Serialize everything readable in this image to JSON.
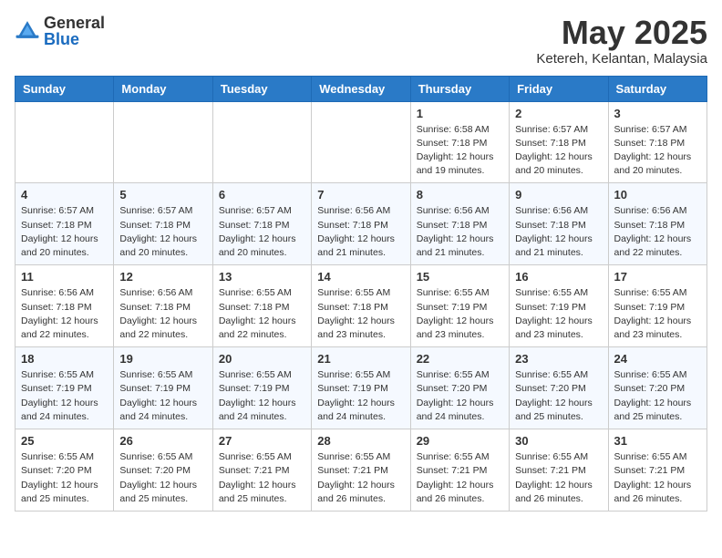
{
  "header": {
    "logo": {
      "general": "General",
      "blue": "Blue"
    },
    "title": "May 2025",
    "location": "Ketereh, Kelantan, Malaysia"
  },
  "weekdays": [
    "Sunday",
    "Monday",
    "Tuesday",
    "Wednesday",
    "Thursday",
    "Friday",
    "Saturday"
  ],
  "weeks": [
    [
      {
        "day": "",
        "info": ""
      },
      {
        "day": "",
        "info": ""
      },
      {
        "day": "",
        "info": ""
      },
      {
        "day": "",
        "info": ""
      },
      {
        "day": "1",
        "info": "Sunrise: 6:58 AM\nSunset: 7:18 PM\nDaylight: 12 hours\nand 19 minutes."
      },
      {
        "day": "2",
        "info": "Sunrise: 6:57 AM\nSunset: 7:18 PM\nDaylight: 12 hours\nand 20 minutes."
      },
      {
        "day": "3",
        "info": "Sunrise: 6:57 AM\nSunset: 7:18 PM\nDaylight: 12 hours\nand 20 minutes."
      }
    ],
    [
      {
        "day": "4",
        "info": "Sunrise: 6:57 AM\nSunset: 7:18 PM\nDaylight: 12 hours\nand 20 minutes."
      },
      {
        "day": "5",
        "info": "Sunrise: 6:57 AM\nSunset: 7:18 PM\nDaylight: 12 hours\nand 20 minutes."
      },
      {
        "day": "6",
        "info": "Sunrise: 6:57 AM\nSunset: 7:18 PM\nDaylight: 12 hours\nand 20 minutes."
      },
      {
        "day": "7",
        "info": "Sunrise: 6:56 AM\nSunset: 7:18 PM\nDaylight: 12 hours\nand 21 minutes."
      },
      {
        "day": "8",
        "info": "Sunrise: 6:56 AM\nSunset: 7:18 PM\nDaylight: 12 hours\nand 21 minutes."
      },
      {
        "day": "9",
        "info": "Sunrise: 6:56 AM\nSunset: 7:18 PM\nDaylight: 12 hours\nand 21 minutes."
      },
      {
        "day": "10",
        "info": "Sunrise: 6:56 AM\nSunset: 7:18 PM\nDaylight: 12 hours\nand 22 minutes."
      }
    ],
    [
      {
        "day": "11",
        "info": "Sunrise: 6:56 AM\nSunset: 7:18 PM\nDaylight: 12 hours\nand 22 minutes."
      },
      {
        "day": "12",
        "info": "Sunrise: 6:56 AM\nSunset: 7:18 PM\nDaylight: 12 hours\nand 22 minutes."
      },
      {
        "day": "13",
        "info": "Sunrise: 6:55 AM\nSunset: 7:18 PM\nDaylight: 12 hours\nand 22 minutes."
      },
      {
        "day": "14",
        "info": "Sunrise: 6:55 AM\nSunset: 7:18 PM\nDaylight: 12 hours\nand 23 minutes."
      },
      {
        "day": "15",
        "info": "Sunrise: 6:55 AM\nSunset: 7:19 PM\nDaylight: 12 hours\nand 23 minutes."
      },
      {
        "day": "16",
        "info": "Sunrise: 6:55 AM\nSunset: 7:19 PM\nDaylight: 12 hours\nand 23 minutes."
      },
      {
        "day": "17",
        "info": "Sunrise: 6:55 AM\nSunset: 7:19 PM\nDaylight: 12 hours\nand 23 minutes."
      }
    ],
    [
      {
        "day": "18",
        "info": "Sunrise: 6:55 AM\nSunset: 7:19 PM\nDaylight: 12 hours\nand 24 minutes."
      },
      {
        "day": "19",
        "info": "Sunrise: 6:55 AM\nSunset: 7:19 PM\nDaylight: 12 hours\nand 24 minutes."
      },
      {
        "day": "20",
        "info": "Sunrise: 6:55 AM\nSunset: 7:19 PM\nDaylight: 12 hours\nand 24 minutes."
      },
      {
        "day": "21",
        "info": "Sunrise: 6:55 AM\nSunset: 7:19 PM\nDaylight: 12 hours\nand 24 minutes."
      },
      {
        "day": "22",
        "info": "Sunrise: 6:55 AM\nSunset: 7:20 PM\nDaylight: 12 hours\nand 24 minutes."
      },
      {
        "day": "23",
        "info": "Sunrise: 6:55 AM\nSunset: 7:20 PM\nDaylight: 12 hours\nand 25 minutes."
      },
      {
        "day": "24",
        "info": "Sunrise: 6:55 AM\nSunset: 7:20 PM\nDaylight: 12 hours\nand 25 minutes."
      }
    ],
    [
      {
        "day": "25",
        "info": "Sunrise: 6:55 AM\nSunset: 7:20 PM\nDaylight: 12 hours\nand 25 minutes."
      },
      {
        "day": "26",
        "info": "Sunrise: 6:55 AM\nSunset: 7:20 PM\nDaylight: 12 hours\nand 25 minutes."
      },
      {
        "day": "27",
        "info": "Sunrise: 6:55 AM\nSunset: 7:21 PM\nDaylight: 12 hours\nand 25 minutes."
      },
      {
        "day": "28",
        "info": "Sunrise: 6:55 AM\nSunset: 7:21 PM\nDaylight: 12 hours\nand 26 minutes."
      },
      {
        "day": "29",
        "info": "Sunrise: 6:55 AM\nSunset: 7:21 PM\nDaylight: 12 hours\nand 26 minutes."
      },
      {
        "day": "30",
        "info": "Sunrise: 6:55 AM\nSunset: 7:21 PM\nDaylight: 12 hours\nand 26 minutes."
      },
      {
        "day": "31",
        "info": "Sunrise: 6:55 AM\nSunset: 7:21 PM\nDaylight: 12 hours\nand 26 minutes."
      }
    ]
  ]
}
